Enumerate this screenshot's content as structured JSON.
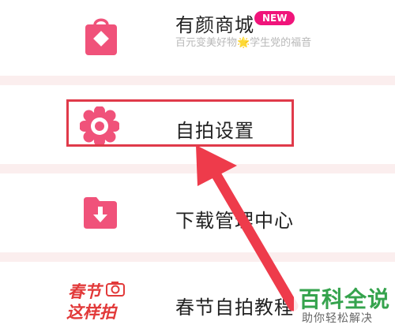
{
  "menu": {
    "items": [
      {
        "title": "有颜商城",
        "badge": "NEW",
        "subtitle": "百元变美好物🌟学生党的福音",
        "icon": "shopping-bag-icon"
      },
      {
        "title": "自拍设置",
        "icon": "flower-gear-icon"
      },
      {
        "title": "下载管理中心",
        "icon": "download-folder-icon"
      },
      {
        "title": "春节自拍教程",
        "icon": "spring-festival-icon",
        "promo_text": [
          "春节",
          "这样拍"
        ]
      }
    ]
  },
  "watermark": {
    "title": "百科全说",
    "subtitle": "助你轻松解决"
  },
  "colors": {
    "accent": "#f0527a",
    "highlight": "#e03a4a",
    "watermark_green": "#35a34d",
    "separator": "#fbeeee"
  }
}
